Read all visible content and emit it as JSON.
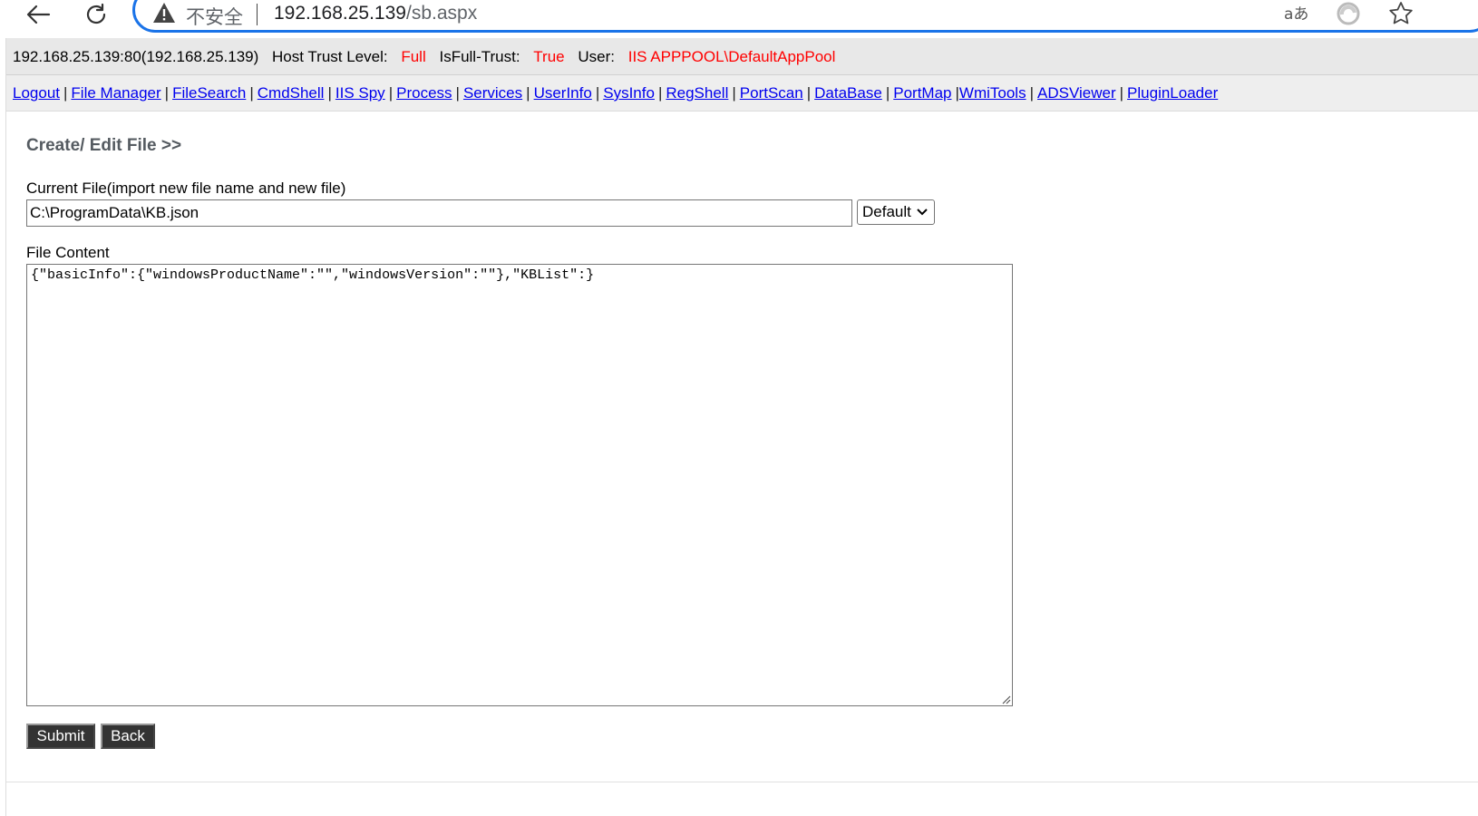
{
  "browser": {
    "security_label": "不安全",
    "url_host": "192.168.25.139",
    "url_path": "/sb.aspx"
  },
  "info": {
    "host": "192.168.25.139:80(192.168.25.139)",
    "trust_label": "Host Trust Level:",
    "trust_value": "Full",
    "fulltrust_label": "IsFull-Trust:",
    "fulltrust_value": "True",
    "user_label": "User:",
    "user_value": "IIS APPPOOL\\DefaultAppPool"
  },
  "menu": {
    "items": [
      "Logout",
      "File Manager",
      "FileSearch",
      "CmdShell",
      "IIS Spy",
      "Process",
      "Services",
      "UserInfo",
      "SysInfo",
      "RegShell",
      "PortScan",
      "DataBase",
      "PortMap",
      "WmiTools",
      "ADSViewer",
      "PluginLoader"
    ]
  },
  "editor": {
    "title": "Create/ Edit File >>",
    "file_label": "Current File(import new file name and new file)",
    "file_path": "C:\\ProgramData\\KB.json",
    "encoding": "Default",
    "content_label": "File Content",
    "content": "{\"basicInfo\":{\"windowsProductName\":\"\",\"windowsVersion\":\"\"},\"KBList\":}",
    "submit_label": "Submit",
    "back_label": "Back"
  },
  "colors": {
    "accent_red": "#ff0000",
    "link_blue": "#0000ee",
    "address_border": "#1a73e8"
  }
}
